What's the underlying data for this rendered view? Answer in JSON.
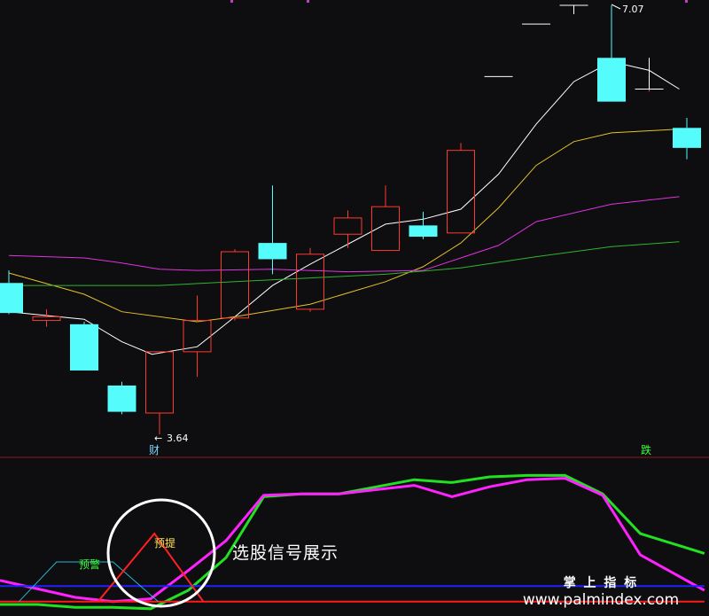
{
  "colors": {
    "background": "#0e0d10",
    "candle_up": "#ff3b30",
    "candle_down": "#54fcfc",
    "ma1": "#ffffff",
    "ma2": "#e6c229",
    "ma3": "#e033e0",
    "ma4": "#2fb52f",
    "divider": "#8b1a1a",
    "ind_green": "#22e022",
    "ind_magenta": "#ff22ff",
    "ind_blue": "#2020ff",
    "ind_red": "#ff1a1a",
    "signal_red": "#ff2020",
    "signal_cyan": "#25b7d3",
    "label_yellow": "#ffe050",
    "label_green": "#3cff3c",
    "label_cyan": "#7fd6ff"
  },
  "annotations": {
    "high": "7.07",
    "low": "3.64",
    "caption": "选股信号展示",
    "char_cai": "财",
    "char_die": "跌",
    "yujing": "预警",
    "yuti": "预提"
  },
  "watermark": {
    "line1": "掌 上 指 标",
    "line2": "www.palmindex.com"
  },
  "chart_data": [
    {
      "type": "candlestick",
      "panel": "price",
      "ylim": [
        3.3,
        7.2
      ],
      "candles": [
        {
          "o": 4.85,
          "h": 4.95,
          "l": 4.6,
          "c": 4.61
        },
        {
          "o": 4.55,
          "h": 4.64,
          "l": 4.5,
          "c": 4.58
        },
        {
          "o": 4.52,
          "h": 4.54,
          "l": 4.15,
          "c": 4.15
        },
        {
          "o": 4.03,
          "h": 4.06,
          "l": 3.8,
          "c": 3.82
        },
        {
          "o": 3.81,
          "h": 4.3,
          "l": 3.64,
          "c": 4.3
        },
        {
          "o": 4.3,
          "h": 4.75,
          "l": 4.1,
          "c": 4.55
        },
        {
          "o": 4.57,
          "h": 5.12,
          "l": 4.55,
          "c": 5.1
        },
        {
          "o": 5.17,
          "h": 5.63,
          "l": 4.92,
          "c": 5.04
        },
        {
          "o": 4.64,
          "h": 5.13,
          "l": 4.62,
          "c": 5.08
        },
        {
          "o": 5.24,
          "h": 5.43,
          "l": 5.13,
          "c": 5.37
        },
        {
          "o": 5.11,
          "h": 5.63,
          "l": 5.11,
          "c": 5.46
        },
        {
          "o": 5.31,
          "h": 5.42,
          "l": 5.2,
          "c": 5.22
        },
        {
          "o": 5.25,
          "h": 5.97,
          "l": 5.25,
          "c": 5.91
        },
        {
          "o": 6.5,
          "h": 6.5,
          "l": 6.5,
          "c": 6.5
        },
        {
          "o": 6.92,
          "h": 6.92,
          "l": 6.92,
          "c": 6.92
        },
        {
          "o": 7.07,
          "h": 7.07,
          "l": 7.07,
          "c": 7.07
        },
        {
          "o": 6.65,
          "h": 7.07,
          "l": 6.3,
          "c": 6.3
        },
        {
          "o": 6.4,
          "h": 6.65,
          "l": 6.38,
          "c": 6.4
        },
        {
          "o": 6.09,
          "h": 6.17,
          "l": 5.84,
          "c": 5.93
        }
      ],
      "series": [
        {
          "name": "MA1",
          "color_key": "ma1",
          "points": [
            [
              0,
              4.62
            ],
            [
              2,
              4.56
            ],
            [
              3,
              4.38
            ],
            [
              3.8,
              4.28
            ],
            [
              5,
              4.34
            ],
            [
              6,
              4.58
            ],
            [
              7,
              4.83
            ],
            [
              8,
              5.0
            ],
            [
              9,
              5.16
            ],
            [
              10,
              5.32
            ],
            [
              11,
              5.36
            ],
            [
              12,
              5.44
            ],
            [
              13,
              5.72
            ],
            [
              14,
              6.12
            ],
            [
              15,
              6.46
            ],
            [
              16,
              6.62
            ],
            [
              17,
              6.55
            ],
            [
              17.8,
              6.4
            ]
          ]
        },
        {
          "name": "MA2",
          "color_key": "ma2",
          "points": [
            [
              0,
              4.93
            ],
            [
              2,
              4.76
            ],
            [
              3,
              4.62
            ],
            [
              5,
              4.54
            ],
            [
              6,
              4.58
            ],
            [
              8,
              4.68
            ],
            [
              10,
              4.86
            ],
            [
              11,
              4.98
            ],
            [
              12,
              5.17
            ],
            [
              13,
              5.45
            ],
            [
              14,
              5.79
            ],
            [
              15,
              5.98
            ],
            [
              16,
              6.05
            ],
            [
              17.8,
              6.08
            ]
          ]
        },
        {
          "name": "MA3",
          "color_key": "ma3",
          "points": [
            [
              0,
              5.07
            ],
            [
              2,
              5.05
            ],
            [
              3,
              5.01
            ],
            [
              4,
              4.96
            ],
            [
              5,
              4.95
            ],
            [
              7,
              4.96
            ],
            [
              9,
              4.94
            ],
            [
              11,
              4.95
            ],
            [
              12,
              5.05
            ],
            [
              13,
              5.15
            ],
            [
              14,
              5.34
            ],
            [
              16,
              5.48
            ],
            [
              17.8,
              5.54
            ]
          ]
        },
        {
          "name": "MA4",
          "color_key": "ma4",
          "points": [
            [
              0,
              4.83
            ],
            [
              2,
              4.83
            ],
            [
              4,
              4.83
            ],
            [
              6,
              4.86
            ],
            [
              8,
              4.89
            ],
            [
              10,
              4.92
            ],
            [
              12,
              4.97
            ],
            [
              14,
              5.06
            ],
            [
              16,
              5.14
            ],
            [
              17.8,
              5.18
            ]
          ]
        }
      ]
    },
    {
      "type": "line",
      "panel": "indicator",
      "ylim": [
        0,
        100
      ],
      "x": [
        0,
        1,
        2,
        3,
        4,
        5,
        6,
        7,
        8,
        9,
        10,
        11,
        12,
        13,
        14,
        15,
        16,
        17,
        18.7
      ],
      "series": [
        {
          "name": "line_green",
          "color_key": "ind_green",
          "values": [
            5,
            5,
            3,
            3,
            2,
            15,
            38,
            81,
            83,
            83,
            88,
            93,
            91,
            95,
            96,
            96,
            83,
            55,
            41
          ]
        },
        {
          "name": "line_magenta",
          "color_key": "ind_magenta",
          "values": [
            22,
            16,
            10,
            7,
            9,
            29,
            50,
            82,
            83,
            83,
            86,
            89,
            81,
            88,
            93,
            94,
            82,
            40,
            15
          ]
        },
        {
          "name": "level_blue",
          "color_key": "ind_blue",
          "values": [
            18,
            18,
            18,
            18,
            18,
            18,
            18,
            18,
            18,
            18,
            18,
            18,
            18,
            18,
            18,
            18,
            18,
            18,
            18
          ]
        },
        {
          "name": "level_red",
          "color_key": "ind_red",
          "values": [
            7,
            7,
            7,
            7,
            7,
            7,
            7,
            7,
            7,
            7,
            7,
            7,
            7,
            7,
            7,
            7,
            7,
            7,
            7
          ]
        }
      ],
      "signals": [
        {
          "label_key": "yujing",
          "color_key": "signal_cyan",
          "points": [
            [
              0.5,
              7
            ],
            [
              1.5,
              35
            ],
            [
              3.0,
              35
            ],
            [
              4.2,
              7
            ]
          ]
        },
        {
          "label_key": "yuti",
          "color_key": "signal_red",
          "points": [
            [
              2.6,
              7
            ],
            [
              4.1,
              55
            ],
            [
              5.4,
              7
            ]
          ]
        }
      ]
    }
  ]
}
